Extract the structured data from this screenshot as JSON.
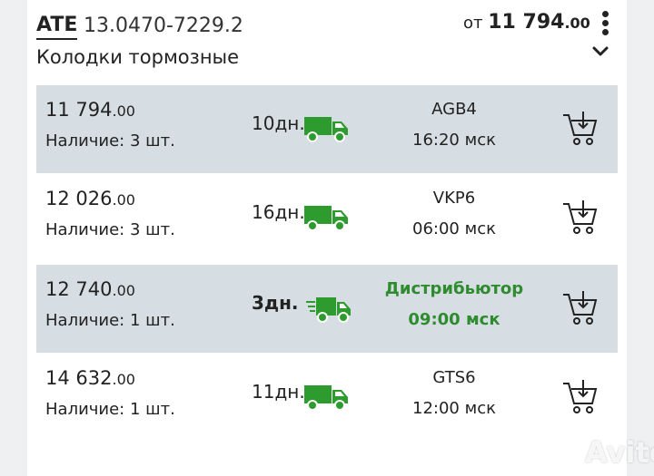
{
  "header": {
    "brand": "ATE",
    "article": "13.0470-7229.2",
    "title": "Колодки тормозные",
    "price_prefix": "от",
    "price_main": "11 794",
    "price_cents": ".00"
  },
  "offers": [
    {
      "price_main": "11 794",
      "price_cents": ".00",
      "stock": "Наличие: 3 шт.",
      "days": "10дн.",
      "code": "AGB4",
      "time": "16:20 мск",
      "shaded": true,
      "highlight": false
    },
    {
      "price_main": "12 026",
      "price_cents": ".00",
      "stock": "Наличие: 3 шт.",
      "days": "16дн.",
      "code": "VKP6",
      "time": "06:00 мск",
      "shaded": false,
      "highlight": false
    },
    {
      "price_main": "12 740",
      "price_cents": ".00",
      "stock": "Наличие: 1 шт.",
      "days": "3дн.",
      "code": "Дистрибьютор",
      "time": "09:00 мск",
      "shaded": true,
      "highlight": true
    },
    {
      "price_main": "14 632",
      "price_cents": ".00",
      "stock": "Наличие: 1 шт.",
      "days": "11дн.",
      "code": "GTS6",
      "time": "12:00 мск",
      "shaded": false,
      "highlight": false
    }
  ],
  "colors": {
    "accent_green": "#2e9b2e",
    "row_shade": "#d6dee3"
  },
  "icons": {
    "delivery": "truck-icon",
    "cart": "add-to-cart-icon",
    "menu": "kebab-menu-icon",
    "expand": "chevron-down-icon"
  },
  "watermark": "Avito"
}
